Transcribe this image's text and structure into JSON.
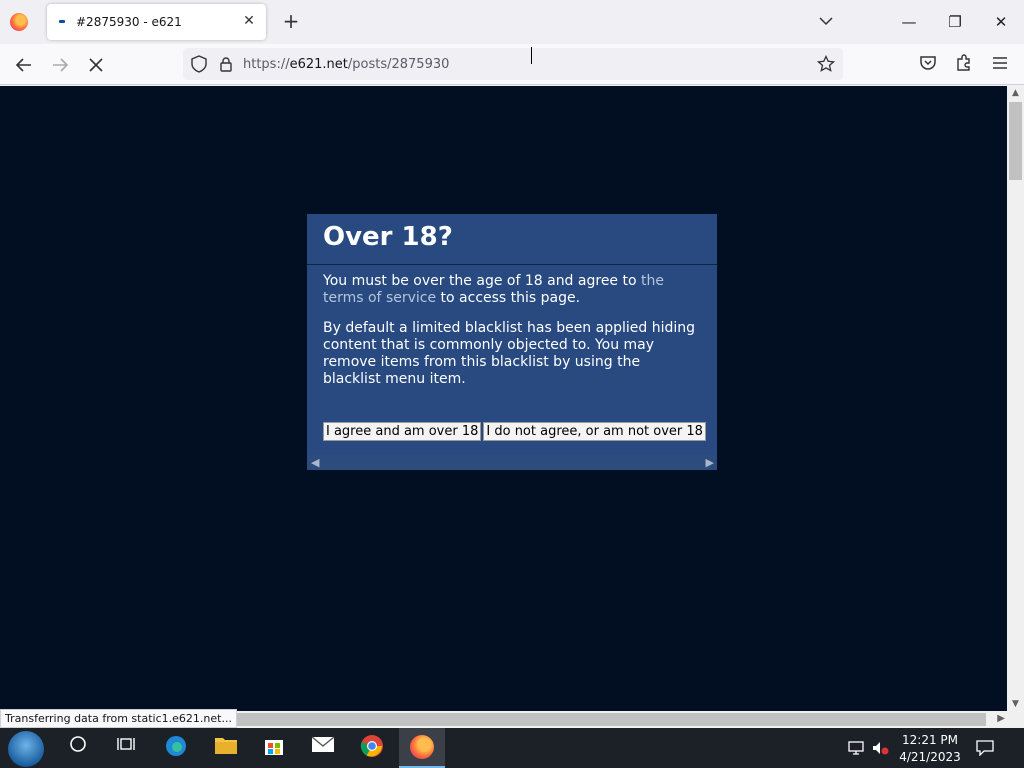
{
  "browser": {
    "tab_title": "#2875930 - e621",
    "tab_close": "✕",
    "new_tab": "+",
    "url_prefix": "https://",
    "url_domain": "e621.net",
    "url_path": "/posts/2875930",
    "loading": true
  },
  "window_controls": {
    "minimize": "—",
    "restore": "❐",
    "close": "✕"
  },
  "modal": {
    "title": "Over 18?",
    "paragraph1_before_link": "You must be over the age of 18 and agree to ",
    "paragraph1_link": "the terms of service",
    "paragraph1_after_link": " to access this page.",
    "paragraph2": "By default a limited blacklist has been applied hiding content that is commonly objected to. You may remove items from this blacklist by using the blacklist menu item.",
    "agree_button": "I agree and am over 18",
    "disagree_button": "I do not agree, or am not over 18"
  },
  "status_bar": "Transferring data from static1.e621.net...",
  "taskbar": {
    "time": "12:21 PM",
    "date": "4/21/2023"
  },
  "colors": {
    "page_background": "#020f23",
    "modal_background": "#284a81",
    "link": "#b4c7d9"
  }
}
